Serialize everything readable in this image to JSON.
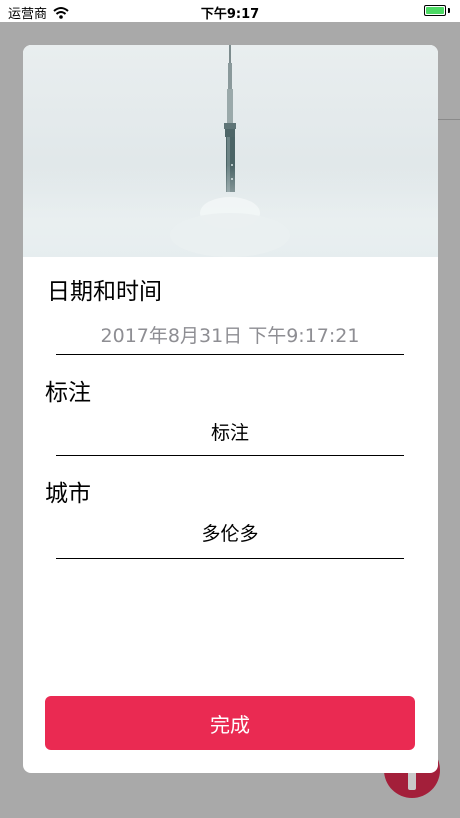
{
  "status_bar": {
    "carrier": "运营商",
    "time": "下午9:17"
  },
  "form": {
    "datetime_label": "日期和时间",
    "datetime_value": "2017年8月31日 下午9:17:21",
    "note_label": "标注",
    "note_value": "标注",
    "city_label": "城市",
    "city_value": "多伦多"
  },
  "done_button": "完成",
  "colors": {
    "accent": "#ea2a52",
    "battery": "#4cd964",
    "overlay": "#a9a9a9",
    "fab": "#a31f3a"
  },
  "icons": [
    "wifi-icon",
    "battery-icon",
    "add-icon"
  ]
}
